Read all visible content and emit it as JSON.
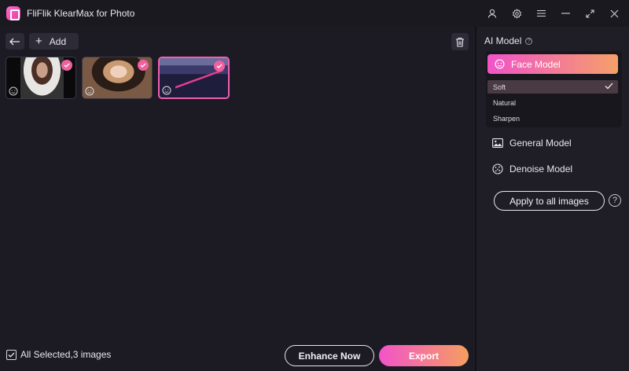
{
  "window": {
    "title": "FliFlik KlearMax for Photo",
    "controls": [
      "user-icon",
      "settings-icon",
      "menu-icon",
      "minimize-icon",
      "maximize-icon",
      "close-icon"
    ]
  },
  "toolbar": {
    "back_icon": "arrow-left-icon",
    "add_label": "Add",
    "trash_icon": "trash-icon"
  },
  "images": [
    {
      "name": "portrait-woman-black-background",
      "selected": true
    },
    {
      "name": "portrait-woman-warm-light",
      "selected": true
    },
    {
      "name": "night-coastline-city",
      "selected": true,
      "active": true
    }
  ],
  "footer": {
    "select_all_label": "All Selected,3 images",
    "select_all_checked": true,
    "enhance_label": "Enhance Now",
    "export_label": "Export"
  },
  "panel": {
    "title": "AI Model",
    "face_model": {
      "label": "Face Model",
      "selected": true,
      "variants": [
        {
          "label": "Soft",
          "selected": true
        },
        {
          "label": "Natural",
          "selected": false
        },
        {
          "label": "Sharpen",
          "selected": false
        }
      ]
    },
    "general_model": {
      "label": "General Model"
    },
    "denoise_model": {
      "label": "Denoise Model"
    },
    "apply_label": "Apply to all images",
    "help_glyph": "?"
  },
  "colors": {
    "accent_start": "#f254c9",
    "accent_end": "#f59e60",
    "check_pink": "#f0609f",
    "background": "#1c1b24"
  }
}
